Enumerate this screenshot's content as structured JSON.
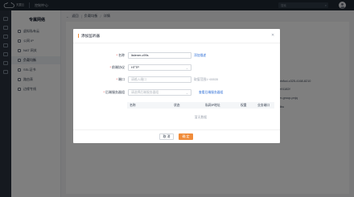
{
  "topbar": {
    "logo_text": "天翼云",
    "nav_label": "控制中心",
    "search_placeholder": "搜索",
    "search_icon": "search-icon"
  },
  "sidebar": {
    "title": "专属网络",
    "items": [
      {
        "label": "虚拟私有云",
        "icon": "cloud-icon"
      },
      {
        "label": "公网 IP",
        "icon": "ip-icon"
      },
      {
        "label": "NAT 网关",
        "icon": "gateway-icon"
      },
      {
        "label": "负载均衡",
        "icon": "balance-icon"
      },
      {
        "label": "SSL证书",
        "icon": "cert-icon"
      },
      {
        "label": "路由表",
        "icon": "route-icon"
      },
      {
        "label": "边缘专线",
        "icon": "line-icon"
      }
    ]
  },
  "breadcrumb": {
    "back": "返回",
    "level1": "负载均衡",
    "level2": "详情"
  },
  "background_fragments": {
    "line1": "ebb8cd-c325-4168-8210",
    "line2": "ae91182f",
    "line3": "ver-group-pnjq",
    "line4": "xdbu"
  },
  "modal": {
    "title": "添加监听器",
    "fields": {
      "name": {
        "label": "名称",
        "value": "listener-c99s",
        "link": "添加描述"
      },
      "protocol": {
        "label": "前端协议",
        "value": "HTTP"
      },
      "port": {
        "label": "端口",
        "placeholder": "请输入端口",
        "hint": "取值范围1~65535"
      },
      "backend": {
        "label": "后端服务器组",
        "placeholder": "请选择后端服务器组",
        "link": "查看后端服务器组"
      }
    },
    "table": {
      "columns": [
        "名称",
        "状态",
        "私网IP地址",
        "权重",
        "业务端口"
      ],
      "empty_text": "暂无数据"
    },
    "buttons": {
      "cancel": "取 消",
      "confirm": "确 定"
    }
  },
  "colors": {
    "accent": "#f08c3a",
    "link": "#2f6fd6",
    "topbar": "#1f2933"
  }
}
